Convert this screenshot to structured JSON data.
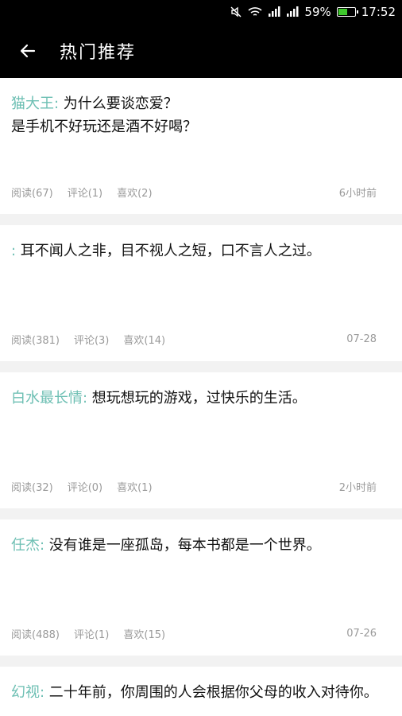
{
  "status_bar": {
    "battery": "59%",
    "battery_level": 0.59,
    "time": "17:52",
    "icons": [
      "mute-icon",
      "wifi-icon",
      "signal-icon",
      "signal-icon",
      "battery-icon"
    ]
  },
  "app_bar": {
    "title": "热门推荐",
    "back_icon": "back-arrow-icon"
  },
  "colors": {
    "author": "#6dbfb3",
    "meta": "#9a9a9a",
    "bar": "#000000",
    "battery_fill": "#3ec82c"
  },
  "posts": [
    {
      "author": "猫大王:",
      "text": " 为什么要谈恋爱？\n是手机不好玩还是酒不好喝？",
      "read": "阅读(67)",
      "comment": "评论(1)",
      "like": "喜欢(2)",
      "time": "6小时前"
    },
    {
      "author": ":",
      "text": " 耳不闻人之非，目不视人之短，口不言人之过。",
      "read": "阅读(381)",
      "comment": "评论(3)",
      "like": "喜欢(14)",
      "time": "07-28"
    },
    {
      "author": "白水最长情:",
      "text": " 想玩想玩的游戏，过快乐的生活。",
      "read": "阅读(32)",
      "comment": "评论(0)",
      "like": "喜欢(1)",
      "time": "2小时前"
    },
    {
      "author": "任杰:",
      "text": " 没有谁是一座孤岛，每本书都是一个世界。",
      "read": "阅读(488)",
      "comment": "评论(1)",
      "like": "喜欢(15)",
      "time": "07-26"
    },
    {
      "author": "幻视:",
      "text": " 二十年前，你周围的人会根据你父母的收入对待你。"
    }
  ]
}
